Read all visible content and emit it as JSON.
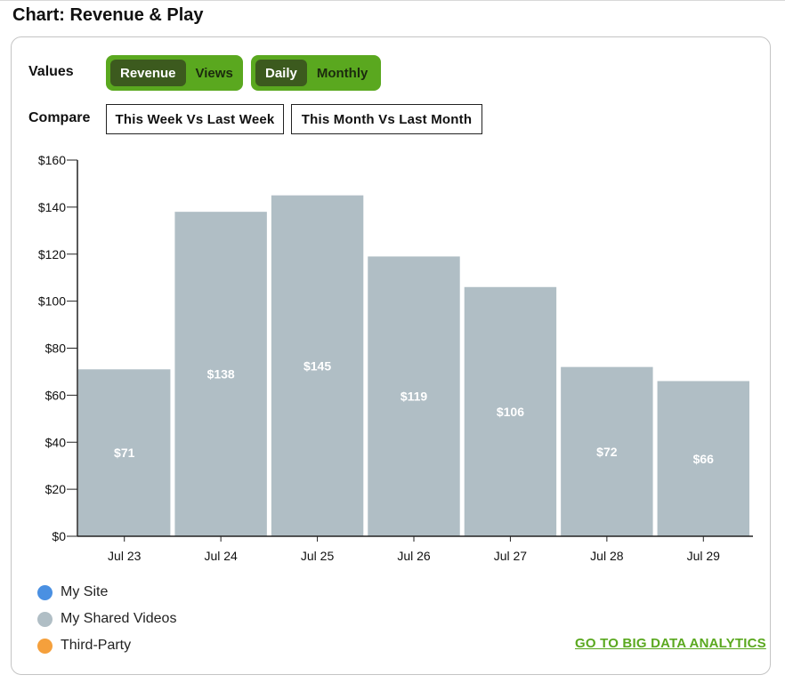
{
  "page_title": "Chart: Revenue & Play",
  "controls": {
    "values_label": "Values",
    "values_options": [
      {
        "label": "Revenue",
        "active": true
      },
      {
        "label": "Views",
        "active": false
      }
    ],
    "period_options": [
      {
        "label": "Daily",
        "active": true
      },
      {
        "label": "Monthly",
        "active": false
      }
    ],
    "compare_label": "Compare",
    "compare_options": [
      "This Week Vs Last Week",
      "This Month Vs Last Month"
    ]
  },
  "legend": [
    {
      "label": "My Site",
      "color": "#4a90e2"
    },
    {
      "label": "My Shared Videos",
      "color": "#b0bec5"
    },
    {
      "label": "Third-Party",
      "color": "#f5a03c"
    }
  ],
  "link": {
    "label": "GO TO BIG DATA ANALYTICS"
  },
  "colors": {
    "accent": "#5aa81f",
    "accent_dark": "#3c5a1e",
    "bar": "#b0bec5"
  },
  "chart_data": {
    "type": "bar",
    "title": "",
    "xlabel": "",
    "ylabel": "",
    "categories": [
      "Jul 23",
      "Jul 24",
      "Jul 25",
      "Jul 26",
      "Jul 27",
      "Jul 28",
      "Jul 29"
    ],
    "values": [
      71,
      138,
      145,
      119,
      106,
      72,
      66
    ],
    "data_labels": [
      "$71",
      "$138",
      "$145",
      "$119",
      "$106",
      "$72",
      "$66"
    ],
    "ylim": [
      0,
      160
    ],
    "yticks": [
      0,
      20,
      40,
      60,
      80,
      100,
      120,
      140,
      160
    ],
    "ytick_labels": [
      "$0",
      "$20",
      "$40",
      "$60",
      "$80",
      "$100",
      "$120",
      "$140",
      "$160"
    ],
    "grid": false,
    "legend_position": "bottom-left"
  }
}
